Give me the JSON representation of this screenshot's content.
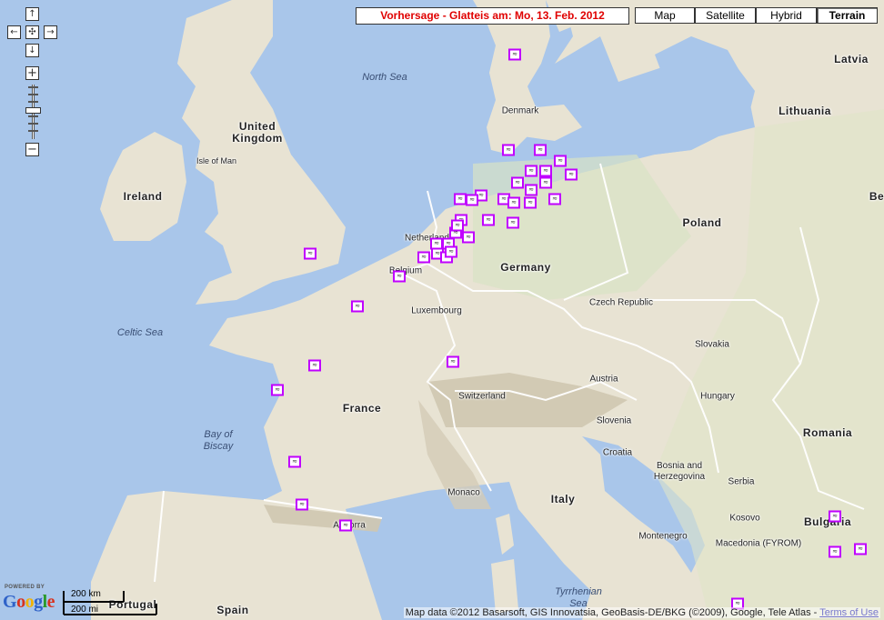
{
  "forecast_banner": "Vorhersage - Glatteis am: Mo, 13. Feb. 2012",
  "map_types": [
    {
      "label": "Map",
      "active": false
    },
    {
      "label": "Satellite",
      "active": false
    },
    {
      "label": "Hybrid",
      "active": false
    },
    {
      "label": "Terrain",
      "active": true
    }
  ],
  "nav_controls": {
    "pan_up": "↑",
    "pan_left": "←",
    "pan_center": "✣",
    "pan_right": "→",
    "pan_down": "↓",
    "zoom_in": "+",
    "zoom_out": "−"
  },
  "labels": {
    "countries": [
      "Ireland",
      "United Kingdom",
      "France",
      "Germany",
      "Poland",
      "Denmark",
      "Latvia",
      "Lithuania",
      "Netherlands",
      "Belgium",
      "Luxembourg",
      "Czech Republic",
      "Slovakia",
      "Austria",
      "Hungary",
      "Romania",
      "Switzerland",
      "Slovenia",
      "Croatia",
      "Bosnia and Herzegovina",
      "Serbia",
      "Italy",
      "Montenegro",
      "Kosovo",
      "Macedonia (FYROM)",
      "Bulgaria",
      "Spain",
      "Portugal",
      "Andorra",
      "Monaco",
      "Be"
    ],
    "seas": [
      "North Sea",
      "Celtic Sea",
      "Bay of Biscay",
      "Tyrrhenian Sea"
    ],
    "islands": [
      "Isle of Man"
    ]
  },
  "marker_icon": "ice-warning-icon",
  "marker_count": 42,
  "scale": {
    "km": "200 km",
    "mi": "200 mi"
  },
  "logo": {
    "powered_by": "POWERED BY",
    "word": "Google"
  },
  "attribution": {
    "text": "Map data ©2012 Basarsoft, GIS Innovatsia, GeoBasis-DE/BKG (©2009), Google, Tele Atlas - ",
    "terms_link": "Terms of Use"
  },
  "colors": {
    "land": "#e8e3d3",
    "water": "#a9c6ea",
    "marker_border": "#c000ff",
    "banner_text": "#e00000"
  }
}
